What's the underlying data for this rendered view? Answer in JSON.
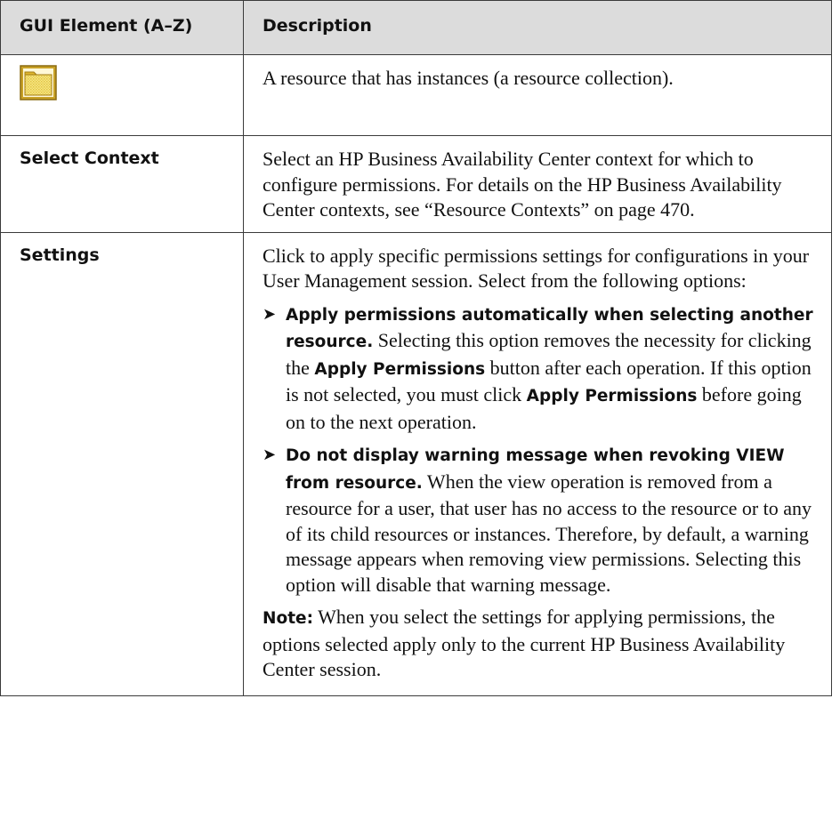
{
  "table": {
    "headers": [
      "GUI Element (A–Z)",
      "Description"
    ],
    "rows": [
      {
        "element_icon": "resource-collection-folder-icon",
        "description": "A resource that has instances (a resource collection)."
      },
      {
        "element": "Select Context",
        "description": "Select an HP Business Availability Center context for which to configure permissions. For details on the HP Business Availability Center contexts, see “Resource Contexts” on page 470."
      },
      {
        "element": "Settings",
        "intro": "Click to apply specific permissions settings for configurations in your User Management session. Select from the following options:",
        "options": [
          {
            "bold": "Apply permissions automatically when selecting another resource.",
            "text_1": " Selecting this option removes the necessity for clicking the ",
            "bold_2": "Apply Permissions",
            "text_2": " button after each operation. If this option is not selected, you must click ",
            "bold_3": "Apply Permissions",
            "text_3": " before going on to the next operation."
          },
          {
            "bold": "Do not display warning message when revoking VIEW from resource.",
            "text_1": " When the view operation is removed from a resource for a user, that user has no access to the resource or to any of its child resources or instances. Therefore, by default, a warning message appears when removing view permissions. Selecting this option will disable that warning message."
          }
        ],
        "note_label": "Note:",
        "note_text": " When you select the settings for applying permissions, the options selected apply only to the current HP Business Availability Center session."
      }
    ],
    "bullet_glyph": "➤"
  },
  "colors": {
    "header_bg": "#dcdcdc",
    "border": "#3b3b3b",
    "icon_yellow": "#f2dc6a",
    "icon_outline": "#a07a10"
  }
}
